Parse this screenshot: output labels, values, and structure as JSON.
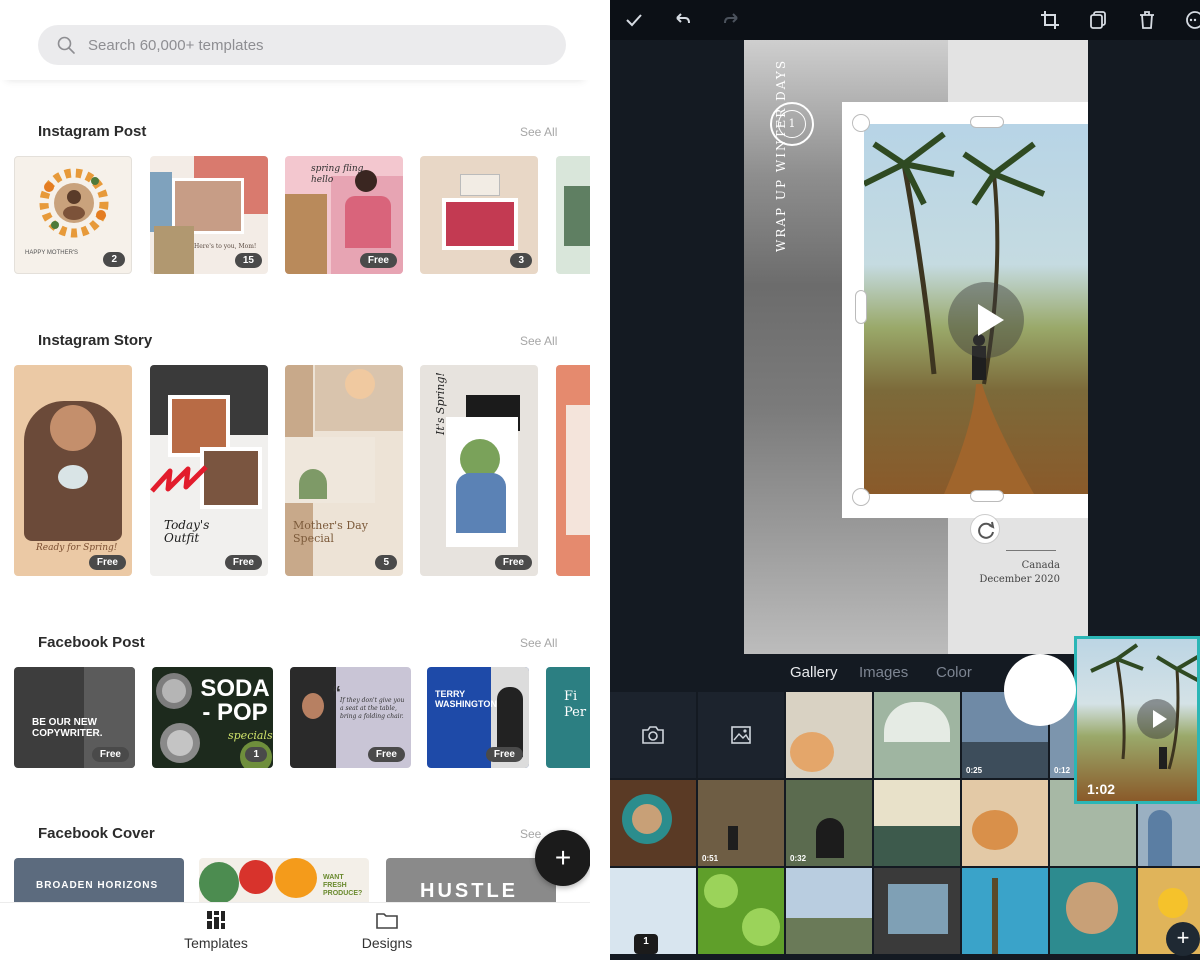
{
  "search": {
    "placeholder": "Search 60,000+ templates"
  },
  "sections": [
    {
      "title": "Instagram Post",
      "see_all": "See All",
      "cards": [
        {
          "text": "HAPPY MOTHER'S",
          "badge": "2"
        },
        {
          "text": "Here's to you, Mom!",
          "badge": "15"
        },
        {
          "text": "spring fling hello",
          "badge": "Free"
        },
        {
          "text": "",
          "badge": "3"
        }
      ]
    },
    {
      "title": "Instagram Story",
      "see_all": "See All",
      "cards": [
        {
          "text": "Ready for Spring!",
          "badge": "Free"
        },
        {
          "text": "Today's Outfit",
          "badge": "Free"
        },
        {
          "text": "Mother's Day Special",
          "badge": "5"
        },
        {
          "text": "It's Spring!",
          "badge": "Free"
        }
      ]
    },
    {
      "title": "Facebook Post",
      "see_all": "See All",
      "cards": [
        {
          "text": "BE OUR NEW COPYWRITER.",
          "badge": "Free"
        },
        {
          "text": "SODA - POP",
          "sub": "specials",
          "badge": "1"
        },
        {
          "text": "If they don't give you a seat at the table, bring a folding chair.",
          "badge": "Free"
        },
        {
          "text": "TERRY WASHINGTON",
          "badge": "Free"
        },
        {
          "text": "Fi Per"
        }
      ]
    },
    {
      "title": "Facebook Cover",
      "see_all": "See",
      "cards": [
        {
          "text": "BROADEN HORIZONS"
        },
        {
          "text": "WANT FRESH PRODUCE?"
        },
        {
          "text": "HUSTLE"
        }
      ]
    }
  ],
  "bottom_nav": {
    "templates": "Templates",
    "designs": "Designs"
  },
  "fab": "+",
  "editor": {
    "badge_number": "1",
    "vertical_text": "WRAP UP WINTER DAYS",
    "caption_place": "Canada",
    "caption_date": "December 2020",
    "tabs": [
      "Gallery",
      "Images",
      "Color"
    ],
    "active_tab": "Gallery",
    "preview_duration": "1:02",
    "durations": [
      "0:25",
      "0:12",
      "0:51",
      "0:32"
    ],
    "page_count": "1",
    "plus": "+"
  }
}
